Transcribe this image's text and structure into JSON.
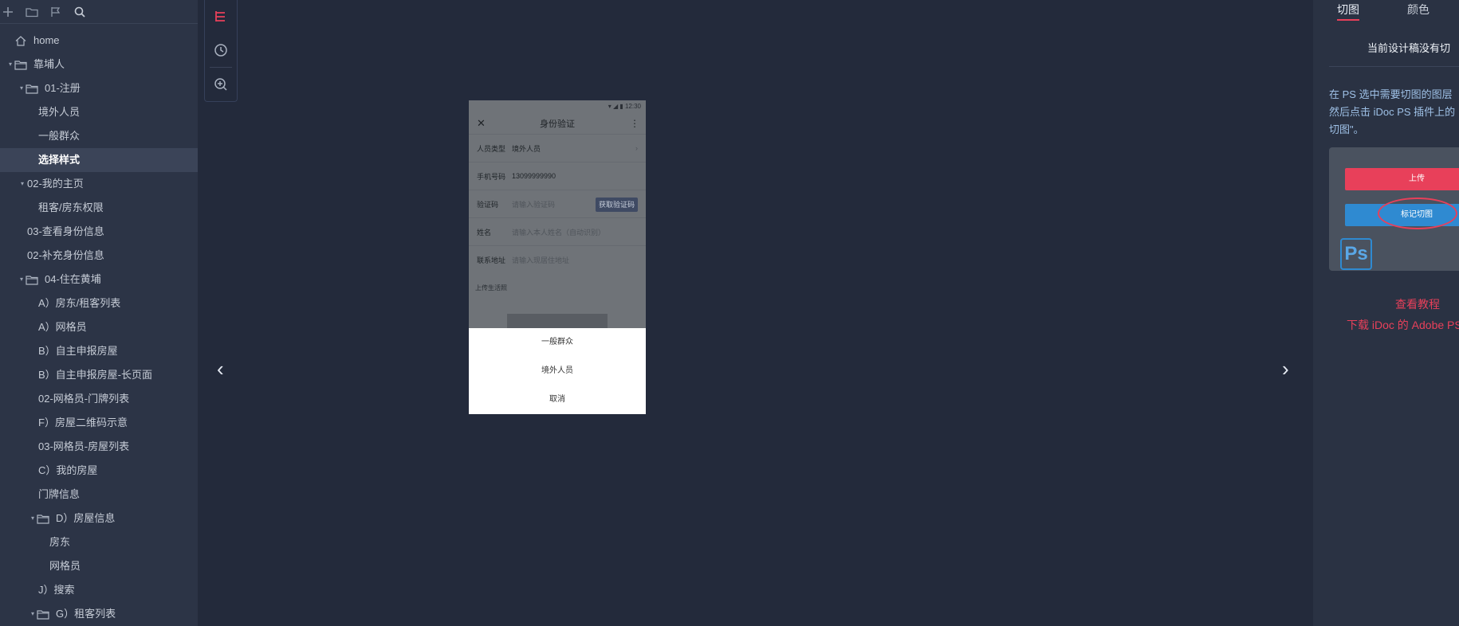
{
  "sidebar": {
    "toolbar_icons": [
      "plus-icon",
      "folder-icon",
      "flag-icon",
      "search-icon"
    ],
    "items": [
      {
        "label": "home",
        "icon": "home-icon",
        "indent": 0,
        "caret": "",
        "active": false
      },
      {
        "label": "靠埔人",
        "icon": "folder-open-icon",
        "indent": 0,
        "caret": "down",
        "active": false
      },
      {
        "label": "01-注册",
        "icon": "folder-open-icon",
        "indent": 1,
        "caret": "down",
        "active": false
      },
      {
        "label": "境外人员",
        "icon": "",
        "indent": 2,
        "caret": "",
        "active": false
      },
      {
        "label": "一般群众",
        "icon": "",
        "indent": 2,
        "caret": "",
        "active": false
      },
      {
        "label": "选择样式",
        "icon": "",
        "indent": 2,
        "caret": "",
        "active": true
      },
      {
        "label": "02-我的主页",
        "icon": "",
        "indent": 1,
        "caret": "down",
        "active": false
      },
      {
        "label": "租客/房东权限",
        "icon": "",
        "indent": 2,
        "caret": "",
        "active": false
      },
      {
        "label": "03-查看身份信息",
        "icon": "",
        "indent": 1,
        "caret": "",
        "active": false
      },
      {
        "label": "02-补充身份信息",
        "icon": "",
        "indent": 1,
        "caret": "",
        "active": false
      },
      {
        "label": "04-住在黄埔",
        "icon": "folder-open-icon",
        "indent": 1,
        "caret": "down",
        "active": false
      },
      {
        "label": "A）房东/租客列表",
        "icon": "",
        "indent": 2,
        "caret": "",
        "active": false
      },
      {
        "label": "A）网格员",
        "icon": "",
        "indent": 2,
        "caret": "",
        "active": false
      },
      {
        "label": "B）自主申报房屋",
        "icon": "",
        "indent": 2,
        "caret": "",
        "active": false
      },
      {
        "label": "B）自主申报房屋-长页面",
        "icon": "",
        "indent": 2,
        "caret": "",
        "active": false
      },
      {
        "label": "02-网格员-门牌列表",
        "icon": "",
        "indent": 2,
        "caret": "",
        "active": false
      },
      {
        "label": "F）房屋二维码示意",
        "icon": "",
        "indent": 2,
        "caret": "",
        "active": false
      },
      {
        "label": "03-网格员-房屋列表",
        "icon": "",
        "indent": 2,
        "caret": "",
        "active": false
      },
      {
        "label": "C）我的房屋",
        "icon": "",
        "indent": 2,
        "caret": "",
        "active": false
      },
      {
        "label": "门牌信息",
        "icon": "",
        "indent": 2,
        "caret": "",
        "active": false
      },
      {
        "label": "D）房屋信息",
        "icon": "folder-open-icon",
        "indent": 2,
        "caret": "down",
        "active": false
      },
      {
        "label": "房东",
        "icon": "",
        "indent": 3,
        "caret": "",
        "active": false
      },
      {
        "label": "网格员",
        "icon": "",
        "indent": 3,
        "caret": "",
        "active": false
      },
      {
        "label": "J）搜索",
        "icon": "",
        "indent": 2,
        "caret": "",
        "active": false
      },
      {
        "label": "G）租客列表",
        "icon": "folder-open-icon",
        "indent": 2,
        "caret": "down",
        "active": false
      }
    ]
  },
  "tools": {
    "items": [
      "tree-icon",
      "history-icon",
      "zoom-in-icon"
    ],
    "accent": "#e8405a"
  },
  "phone": {
    "status_time": "12:30",
    "title": "身份验证",
    "rows": [
      {
        "label": "人员类型",
        "value": "境外人员",
        "placeholder": false,
        "chevron": true
      },
      {
        "label": "手机号码",
        "value": "13099999990",
        "placeholder": false,
        "chevron": false
      },
      {
        "label": "验证码",
        "value": "请输入验证码",
        "placeholder": true,
        "chevron": false
      },
      {
        "label": "姓名",
        "value": "请输入本人姓名（自动识别）",
        "placeholder": true,
        "chevron": false
      },
      {
        "label": "联系地址",
        "value": "请输入现居住地址",
        "placeholder": true,
        "chevron": false
      }
    ],
    "code_button": "获取验证码",
    "section_label": "上传生活照",
    "sheet_options": [
      "一般群众",
      "境外人员",
      "取消"
    ]
  },
  "nav": {
    "prev": "‹",
    "next": "›"
  },
  "panel": {
    "tabs": [
      {
        "label": "切图",
        "active": true
      },
      {
        "label": "颜色",
        "active": false
      }
    ],
    "notice": "当前设计稿没有切",
    "instructions": [
      "在 PS 选中需要切图的图层",
      "然后点击 iDoc PS 插件上的",
      "切图\"。"
    ],
    "illustration": {
      "upload_label": "上传",
      "mark_label": "标记切图",
      "ps_label": "Ps"
    },
    "links": [
      "查看教程",
      "下载 iDoc 的 Adobe PS"
    ]
  },
  "colors": {
    "background": "#232a3b",
    "sidebar": "#2c3446",
    "accent": "#e8405a",
    "link_blue": "#9ec0e6"
  }
}
